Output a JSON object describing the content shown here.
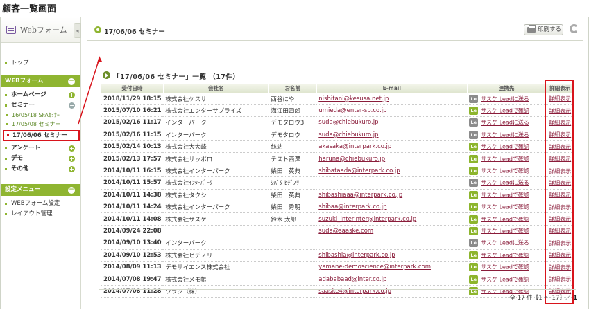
{
  "page_title": "顧客一覧画面",
  "sidebar": {
    "brand": "Webフォーム",
    "collapse_glyph": "◂",
    "top_item": "トップ",
    "section_webform": "WEBフォーム",
    "items": [
      {
        "label": "ホームページ",
        "toggle": "+"
      },
      {
        "label": "セミナー",
        "toggle": "−"
      }
    ],
    "sub_items": [
      "16/05/18 SFAｾﾐﾅｰ",
      "17/05/08 セミナー"
    ],
    "current_item": "17/06/06 セミナー",
    "items2": [
      {
        "label": "アンケート",
        "toggle": "+"
      },
      {
        "label": "デモ",
        "toggle": "+"
      },
      {
        "label": "その他",
        "toggle": "+"
      }
    ],
    "section_settings": "設定メニュー",
    "settings_items": [
      "WEBフォーム設定",
      "レイアウト管理"
    ],
    "section_toggle": "−"
  },
  "main": {
    "heading": "17/06/06 セミナー",
    "print_label": "印刷する",
    "list_title": "「17/06/06 セミナー」一覧 （17件）",
    "columns": [
      "受付日時",
      "会社名",
      "お名前",
      "E-mail",
      "連携先",
      "詳細表示"
    ],
    "rows": [
      {
        "date": "2018/11/29 18:15",
        "company": "株式会社ケスサ",
        "name": "西谷にや",
        "email": "nishitani@kesusa.net.jp",
        "lead": "サスケ Leadに送る",
        "lead_state": "s",
        "detail": "詳細表示"
      },
      {
        "date": "2015/07/10 16:21",
        "company": "株式会社エンターサプライズ",
        "name": "海江田四郎",
        "email": "umieda@enter-sp.co.jp",
        "lead": "サスケ Leadで確認",
        "lead_state": "g",
        "detail": "詳細表示"
      },
      {
        "date": "2015/02/16 11:17",
        "company": "インターパーク",
        "name": "デモタロウ3",
        "email": "suda@chiebukuro.jp",
        "lead": "サスケ Leadに送る",
        "lead_state": "s",
        "detail": "詳細表示"
      },
      {
        "date": "2015/02/16 11:15",
        "company": "インターパーク",
        "name": "デモタロウ",
        "email": "suda@chiebukuro.jp",
        "lead": "サスケ Leadに送る",
        "lead_state": "s",
        "detail": "詳細表示"
      },
      {
        "date": "2015/02/14 10:13",
        "company": "株式会社大大峰",
        "name": "絲站",
        "email": "akasaka@interpark.co.jp",
        "lead": "サスケ Leadで確認",
        "lead_state": "g",
        "detail": "詳細表示"
      },
      {
        "date": "2015/02/13 17:57",
        "company": "株式会社サッポロ",
        "name": "テスト西澤",
        "email": "haruna@chiebukuro.jp",
        "lead": "サスケ Leadで確認",
        "lead_state": "g",
        "detail": "詳細表示"
      },
      {
        "date": "2014/10/11 16:15",
        "company": "株式会社インターパーク",
        "name": "柴田　英典",
        "email": "shibataada@interpark.co.jp",
        "lead": "サスケ Leadで確認",
        "lead_state": "g",
        "detail": "詳細表示"
      },
      {
        "date": "2014/10/11 15:57",
        "company": "株式会社ｲﾝﾀｰﾊﾟｰｸ",
        "name": "ｼﾊﾞﾀ ﾋﾃﾞﾉﾘ",
        "email": "",
        "lead": "サスケ Leadに送る",
        "lead_state": "s",
        "detail": "詳細表示"
      },
      {
        "date": "2014/10/11 14:38",
        "company": "株式会社タクシ",
        "name": "柴田　英典",
        "email": "shibashiaaa@interpark.co.jp",
        "lead": "サスケ Leadで確認",
        "lead_state": "g",
        "detail": "詳細表示"
      },
      {
        "date": "2014/10/11 14:24",
        "company": "株式会社インターパーク",
        "name": "柴田　秀明",
        "email": "shibaa@interpark.co.jp",
        "lead": "サスケ Leadで確認",
        "lead_state": "g",
        "detail": "詳細表示"
      },
      {
        "date": "2014/10/11 14:08",
        "company": "株式会社サスケ",
        "name": "鈴木 太郎",
        "email": "suzuki_interinter@interpark.co.jp",
        "lead": "サスケ Leadで確認",
        "lead_state": "g",
        "detail": "詳細表示"
      },
      {
        "date": "2014/09/24 22:08",
        "company": "",
        "name": "",
        "email": "suda@saaske.com",
        "lead": "サスケ Leadで確認",
        "lead_state": "g",
        "detail": "詳細表示"
      },
      {
        "date": "2014/09/10 13:40",
        "company": "インターパーク",
        "name": "",
        "email": "",
        "lead": "サスケ Leadに送る",
        "lead_state": "s",
        "detail": "詳細表示"
      },
      {
        "date": "2014/09/10 12:53",
        "company": "株式会社ヒデノリ",
        "name": "",
        "email": "shibashia@interpark.co.jp",
        "lead": "サスケ Leadで確認",
        "lead_state": "g",
        "detail": "詳細表示"
      },
      {
        "date": "2014/08/09 11:13",
        "company": "デモサイエンス株式会社",
        "name": "",
        "email": "yamane-demoscience@interpark.com",
        "lead": "サスケ Leadで確認",
        "lead_state": "g",
        "detail": "詳細表示"
      },
      {
        "date": "2014/07/08 19:47",
        "company": "株式会社メモ帳",
        "name": "",
        "email": "adababaad@inter.co.jp",
        "lead": "サスケ Leadで確認",
        "lead_state": "g",
        "detail": "詳細表示"
      },
      {
        "date": "2014/07/08 11:28",
        "company": "ワラジ（株）",
        "name": "",
        "email": "saaske4@interpark.co.jp",
        "lead": "サスケ Leadで確認",
        "lead_state": "g",
        "detail": "詳細表示"
      }
    ],
    "badge_text": "Le",
    "pager_text": "全 17 件【1 ～ 17】／",
    "pager_page": "1"
  },
  "colors": {
    "accent": "#8fb531",
    "highlight": "#d8141c",
    "link": "#8a1c3a"
  }
}
